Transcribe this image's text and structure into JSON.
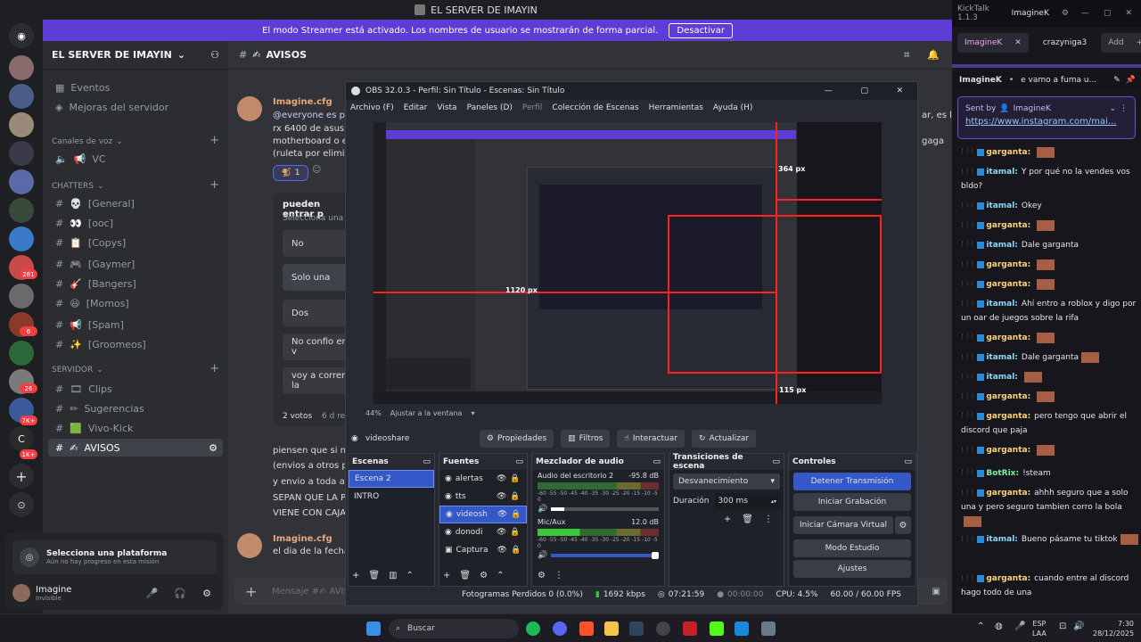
{
  "discord": {
    "window_title": "EL SERVER DE IMAYIN",
    "streamer_banner": "El modo Streamer está activado. Los nombres de usuario se mostrarán de forma parcial.",
    "streamer_button": "Desactivar",
    "server_name": "EL SERVER DE IMAYIN",
    "nav_items": [
      "Eventos",
      "Mejoras del servidor"
    ],
    "voice_category": "Canales de voz",
    "voice_channel": "VC",
    "chatters_category": "CHATTERS",
    "chatter_channels": [
      "[General]",
      "[ooc]",
      "[Copys]",
      "[Gaymer]",
      "[Bangers]",
      "[Momos]",
      "[Spam]",
      "[Groomeos]"
    ],
    "servidor_category": "SERVIDOR",
    "servidor_channels": [
      "Clips",
      "Sugerencias",
      "Vivo-Kick",
      "AVISOS"
    ],
    "guild_badges": [
      "281",
      "6",
      "26",
      "7K+",
      "1K+"
    ],
    "platform_title": "Selecciona una plataforma",
    "platform_subtitle": "Aún no hay progreso en esta misión",
    "user_name": "Imagine",
    "user_status": "Invisible",
    "channel_header": "AVISOS",
    "msg_author": "Imagine.cfg",
    "msg_lines": [
      "@everyone es po",
      "rx 6400 de asus u",
      "motherboard o en",
      "(ruleta por elimina"
    ],
    "reaction_count": "1",
    "poll_question": "pueden entrar p",
    "poll_subtitle": "Selecciona una o",
    "poll_options": [
      "No",
      "Solo una",
      "Dos",
      "No confio en v",
      "voy a correr la"
    ],
    "poll_votes": "2 votos",
    "poll_time": "6 d re",
    "msg2_lines": [
      "piensen que si no",
      "(envios a otros pai",
      "y envio a toda arge",
      "SEPAN QUE LA PL",
      "VIENE CON CAJA"
    ],
    "msg3_author": "Imagine.cfg",
    "msg3_line": "el dia de la fecha l",
    "right_fragments": [
      "ar, es la",
      "gaga"
    ],
    "composer_placeholder": "Mensaje #✍ AVIS"
  },
  "obs": {
    "title": "OBS 32.0.3 - Perfil: Sin Título - Escenas: Sin Título",
    "menu": [
      "Archivo (F)",
      "Editar",
      "Vista",
      "Paneles (D)",
      "Perfil",
      "Colección de Escenas",
      "Herramientas",
      "Ayuda (H)"
    ],
    "zoom": "44%",
    "fit_label": "Ajustar a la ventana",
    "preview_labels": [
      "364 px",
      "1120 px",
      "115 px"
    ],
    "source_name": "videoshare",
    "source_buttons": [
      "Propiedades",
      "Filtros",
      "Interactuar",
      "Actualizar"
    ],
    "scenes_title": "Escenas",
    "scenes": [
      "Escena 2",
      "INTRO"
    ],
    "sources_title": "Fuentes",
    "sources": [
      "alertas",
      "tts",
      "videosh",
      "donodi",
      "Captura"
    ],
    "mixer_title": "Mezclador de audio",
    "mixer_channels": [
      {
        "name": "Audio del escritorio 2",
        "db": "-95.8 dB"
      },
      {
        "name": "Mic/Aux",
        "db": "12.0 dB"
      }
    ],
    "meter_scale": "-60 -55 -50 -45 -40 -35 -30 -25 -20 -15 -10 -5 0",
    "transitions_title": "Transiciones de escena",
    "transition": "Desvanecimiento",
    "duration_label": "Duración",
    "duration": "300 ms",
    "controls_title": "Controles",
    "controls": [
      "Detener Transmisión",
      "Iniciar Grabación",
      "Iniciar Cámara Virtual",
      "Modo Estudio",
      "Ajustes"
    ],
    "status": {
      "dropped": "Fotogramas Perdidos 0 (0.0%)",
      "bitrate": "1692 kbps",
      "stream_time": "07:21:59",
      "rec_time": "00:00:00",
      "cpu": "CPU: 4.5%",
      "fps": "60.00 / 60.00 FPS"
    }
  },
  "kick": {
    "app": "KickTalk 1.1.3",
    "account": "ImagineK",
    "tabs": [
      "ImagineK",
      "crazyniga3",
      "Add"
    ],
    "top_user": "ImagineK",
    "top_text": "e vamo a fuma u...",
    "sent_by_label": "Sent by",
    "sent_by_user": "ImagineK",
    "sent_link": "https://www.instagram.com/mai...",
    "messages": [
      {
        "user": "garganta:",
        "text": "",
        "emote": true
      },
      {
        "user": "itamal:",
        "text": "Y por qué no la vendes vos bldo?",
        "emote": false
      },
      {
        "user": "itamal:",
        "text": "Okey",
        "emote": false
      },
      {
        "user": "garganta:",
        "text": "",
        "emote": true
      },
      {
        "user": "itamal:",
        "text": "Dale garganta",
        "emote": false
      },
      {
        "user": "garganta:",
        "text": "",
        "emote": true
      },
      {
        "user": "garganta:",
        "text": "",
        "emote": true
      },
      {
        "user": "itamal:",
        "text": "Ahí entro a roblox y digo por un oar de juegos sobre la rifa",
        "emote": false
      },
      {
        "user": "garganta:",
        "text": "",
        "emote": true
      },
      {
        "user": "itamal:",
        "text": "Dale garganta",
        "emote": true
      },
      {
        "user": "itamal:",
        "text": "",
        "emote": true
      },
      {
        "user": "garganta:",
        "text": "",
        "emote": true
      },
      {
        "user": "garganta:",
        "text": "pero tengo que abrir el discord que paja",
        "emote": false
      },
      {
        "user": "garganta:",
        "text": "",
        "emote": true
      },
      {
        "user": "BotRix:",
        "text": "!steam",
        "emote": false
      },
      {
        "user": "garganta:",
        "text": "ahhh seguro que a solo una y pero seguro tambien corro la bola",
        "emote": true
      },
      {
        "user": "itamal:",
        "text": "Bueno pásame tu tiktok",
        "emote": true
      },
      {
        "user": "garganta:",
        "text": "cuando entre al discord hago todo de una",
        "emote": false
      }
    ]
  },
  "taskbar": {
    "search": "Buscar",
    "lang": "ESP",
    "lang2": "LAA",
    "time": "7:30",
    "date": "28/12/2025"
  },
  "colors": {
    "discord_bg": "#313338",
    "streamer_banner": "#5d3dd6",
    "obs_accent": "#3458c8",
    "kick_green": "#53fc18",
    "guide_red": "#ff2020"
  }
}
